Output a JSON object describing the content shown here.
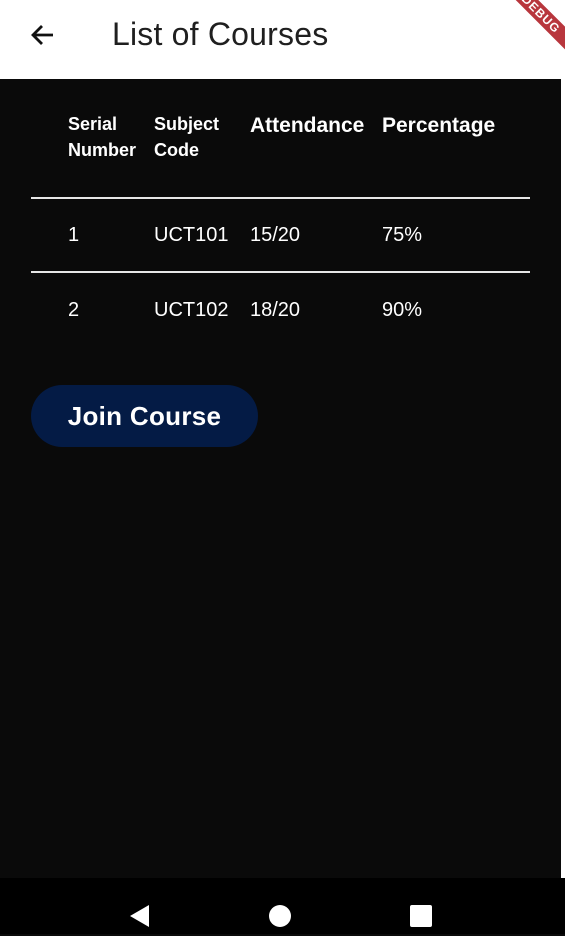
{
  "app_bar": {
    "title": "List of Courses",
    "debug_banner": "DEBUG",
    "back_icon": "arrow-left-icon"
  },
  "table": {
    "headers": {
      "serial_line1": "Serial",
      "serial_line2": "Number",
      "subject_line1": "Subject",
      "subject_line2": "Code",
      "attendance": "Attendance",
      "percentage": "Percentage"
    },
    "rows": [
      {
        "serial": "1",
        "subject_code": "UCT101",
        "attendance": "15/20",
        "percentage": "75%"
      },
      {
        "serial": "2",
        "subject_code": "UCT102",
        "attendance": "18/20",
        "percentage": "90%"
      }
    ]
  },
  "join_button": {
    "label": "Join Course",
    "color": "#041b45"
  },
  "nav_bar": {
    "back_icon": "triangle-back-icon",
    "home_icon": "circle-home-icon",
    "recents_icon": "square-recents-icon"
  }
}
